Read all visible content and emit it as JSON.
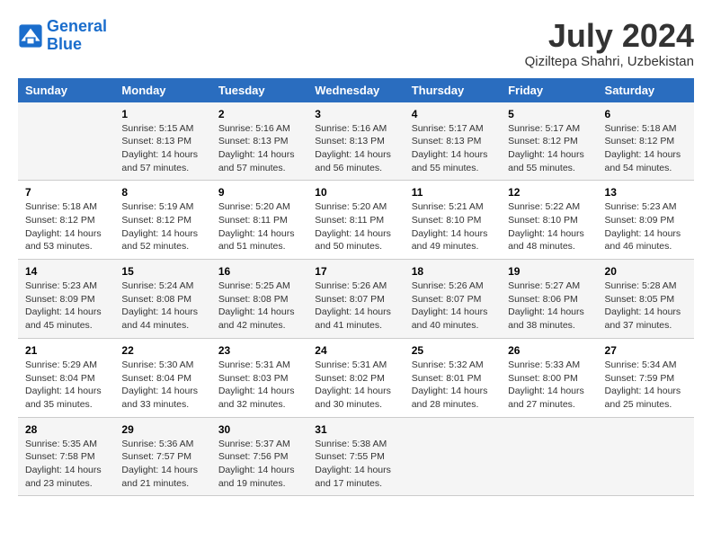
{
  "logo": {
    "line1": "General",
    "line2": "Blue"
  },
  "title": "July 2024",
  "location": "Qiziltepa Shahri, Uzbekistan",
  "days_of_week": [
    "Sunday",
    "Monday",
    "Tuesday",
    "Wednesday",
    "Thursday",
    "Friday",
    "Saturday"
  ],
  "weeks": [
    [
      {
        "day": "",
        "info": ""
      },
      {
        "day": "1",
        "info": "Sunrise: 5:15 AM\nSunset: 8:13 PM\nDaylight: 14 hours\nand 57 minutes."
      },
      {
        "day": "2",
        "info": "Sunrise: 5:16 AM\nSunset: 8:13 PM\nDaylight: 14 hours\nand 57 minutes."
      },
      {
        "day": "3",
        "info": "Sunrise: 5:16 AM\nSunset: 8:13 PM\nDaylight: 14 hours\nand 56 minutes."
      },
      {
        "day": "4",
        "info": "Sunrise: 5:17 AM\nSunset: 8:13 PM\nDaylight: 14 hours\nand 55 minutes."
      },
      {
        "day": "5",
        "info": "Sunrise: 5:17 AM\nSunset: 8:12 PM\nDaylight: 14 hours\nand 55 minutes."
      },
      {
        "day": "6",
        "info": "Sunrise: 5:18 AM\nSunset: 8:12 PM\nDaylight: 14 hours\nand 54 minutes."
      }
    ],
    [
      {
        "day": "7",
        "info": "Sunrise: 5:18 AM\nSunset: 8:12 PM\nDaylight: 14 hours\nand 53 minutes."
      },
      {
        "day": "8",
        "info": "Sunrise: 5:19 AM\nSunset: 8:12 PM\nDaylight: 14 hours\nand 52 minutes."
      },
      {
        "day": "9",
        "info": "Sunrise: 5:20 AM\nSunset: 8:11 PM\nDaylight: 14 hours\nand 51 minutes."
      },
      {
        "day": "10",
        "info": "Sunrise: 5:20 AM\nSunset: 8:11 PM\nDaylight: 14 hours\nand 50 minutes."
      },
      {
        "day": "11",
        "info": "Sunrise: 5:21 AM\nSunset: 8:10 PM\nDaylight: 14 hours\nand 49 minutes."
      },
      {
        "day": "12",
        "info": "Sunrise: 5:22 AM\nSunset: 8:10 PM\nDaylight: 14 hours\nand 48 minutes."
      },
      {
        "day": "13",
        "info": "Sunrise: 5:23 AM\nSunset: 8:09 PM\nDaylight: 14 hours\nand 46 minutes."
      }
    ],
    [
      {
        "day": "14",
        "info": "Sunrise: 5:23 AM\nSunset: 8:09 PM\nDaylight: 14 hours\nand 45 minutes."
      },
      {
        "day": "15",
        "info": "Sunrise: 5:24 AM\nSunset: 8:08 PM\nDaylight: 14 hours\nand 44 minutes."
      },
      {
        "day": "16",
        "info": "Sunrise: 5:25 AM\nSunset: 8:08 PM\nDaylight: 14 hours\nand 42 minutes."
      },
      {
        "day": "17",
        "info": "Sunrise: 5:26 AM\nSunset: 8:07 PM\nDaylight: 14 hours\nand 41 minutes."
      },
      {
        "day": "18",
        "info": "Sunrise: 5:26 AM\nSunset: 8:07 PM\nDaylight: 14 hours\nand 40 minutes."
      },
      {
        "day": "19",
        "info": "Sunrise: 5:27 AM\nSunset: 8:06 PM\nDaylight: 14 hours\nand 38 minutes."
      },
      {
        "day": "20",
        "info": "Sunrise: 5:28 AM\nSunset: 8:05 PM\nDaylight: 14 hours\nand 37 minutes."
      }
    ],
    [
      {
        "day": "21",
        "info": "Sunrise: 5:29 AM\nSunset: 8:04 PM\nDaylight: 14 hours\nand 35 minutes."
      },
      {
        "day": "22",
        "info": "Sunrise: 5:30 AM\nSunset: 8:04 PM\nDaylight: 14 hours\nand 33 minutes."
      },
      {
        "day": "23",
        "info": "Sunrise: 5:31 AM\nSunset: 8:03 PM\nDaylight: 14 hours\nand 32 minutes."
      },
      {
        "day": "24",
        "info": "Sunrise: 5:31 AM\nSunset: 8:02 PM\nDaylight: 14 hours\nand 30 minutes."
      },
      {
        "day": "25",
        "info": "Sunrise: 5:32 AM\nSunset: 8:01 PM\nDaylight: 14 hours\nand 28 minutes."
      },
      {
        "day": "26",
        "info": "Sunrise: 5:33 AM\nSunset: 8:00 PM\nDaylight: 14 hours\nand 27 minutes."
      },
      {
        "day": "27",
        "info": "Sunrise: 5:34 AM\nSunset: 7:59 PM\nDaylight: 14 hours\nand 25 minutes."
      }
    ],
    [
      {
        "day": "28",
        "info": "Sunrise: 5:35 AM\nSunset: 7:58 PM\nDaylight: 14 hours\nand 23 minutes."
      },
      {
        "day": "29",
        "info": "Sunrise: 5:36 AM\nSunset: 7:57 PM\nDaylight: 14 hours\nand 21 minutes."
      },
      {
        "day": "30",
        "info": "Sunrise: 5:37 AM\nSunset: 7:56 PM\nDaylight: 14 hours\nand 19 minutes."
      },
      {
        "day": "31",
        "info": "Sunrise: 5:38 AM\nSunset: 7:55 PM\nDaylight: 14 hours\nand 17 minutes."
      },
      {
        "day": "",
        "info": ""
      },
      {
        "day": "",
        "info": ""
      },
      {
        "day": "",
        "info": ""
      }
    ]
  ]
}
